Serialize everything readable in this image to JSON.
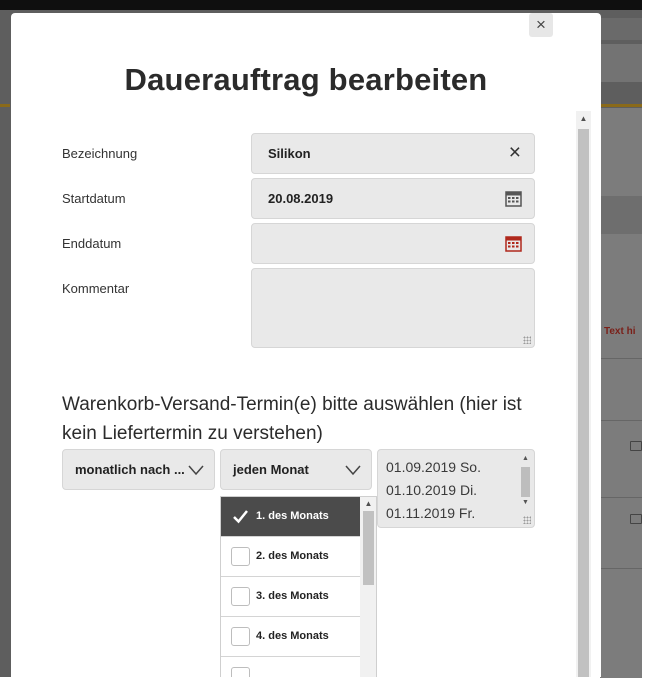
{
  "modal": {
    "title": "Dauerauftrag bearbeiten",
    "close_glyph": "×"
  },
  "form": {
    "name": {
      "label": "Bezeichnung",
      "value": "Silikon",
      "clear_glyph": "×",
      "icon": "clear-icon"
    },
    "start_date": {
      "label": "Startdatum",
      "value": "20.08.2019",
      "icon": "calendar-icon",
      "icon_color": "#555555"
    },
    "end_date": {
      "label": "Enddatum",
      "value": "",
      "icon": "calendar-icon",
      "icon_color": "#b0281c"
    },
    "comment": {
      "label": "Kommentar",
      "value": ""
    }
  },
  "schedule": {
    "heading": "Warenkorb-Versand-Termin(e) bitte auswählen (hier ist kein Liefertermin zu verstehen)",
    "frequency_select": {
      "value": "monatlich nach ...",
      "icon": "chevron-down-icon"
    },
    "interval_select": {
      "value": "jeden Monat",
      "icon": "chevron-down-icon"
    },
    "dates": [
      "01.09.2019 So.",
      "01.10.2019 Di.",
      "01.11.2019 Fr."
    ],
    "day_options": [
      {
        "label": "1. des Monats",
        "checked": true
      },
      {
        "label": "2. des Monats",
        "checked": false
      },
      {
        "label": "3. des Monats",
        "checked": false
      },
      {
        "label": "4. des Monats",
        "checked": false
      },
      {
        "label": "",
        "checked": false
      }
    ]
  },
  "background_page": {
    "fragment_text": "Text hi"
  },
  "colors": {
    "selected_option": "#4b4b4b",
    "field_background": "#e9e9e9",
    "end_date_calendar": "#b0281c"
  }
}
